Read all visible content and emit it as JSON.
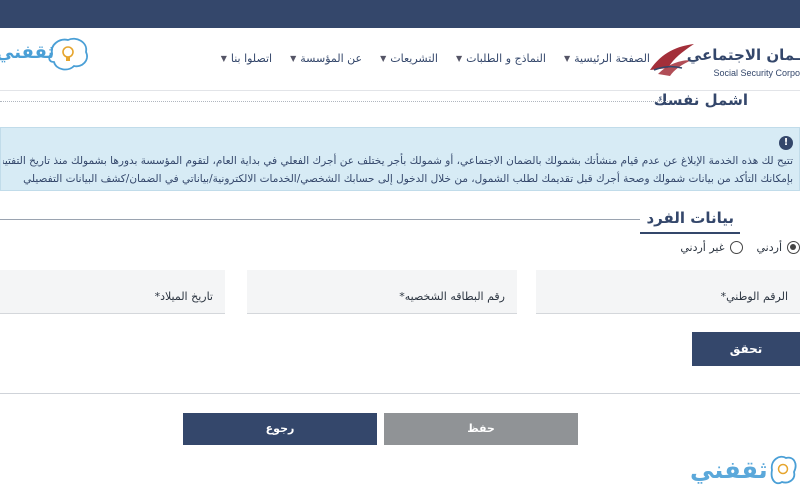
{
  "header": {
    "logo_ar": "ـمان الاجتماعي",
    "logo_en": "Social Security Corpo",
    "brand_left": "ثقفني"
  },
  "nav": {
    "items": [
      {
        "label": "الصفحة الرئيسية"
      },
      {
        "label": "النماذج و الطلبات"
      },
      {
        "label": "التشريعات"
      },
      {
        "label": "عن المؤسسة"
      },
      {
        "label": "اتصلوا بنا"
      }
    ]
  },
  "page": {
    "title": "اشمل نفسك"
  },
  "info": {
    "icon": "!",
    "line1": "تتيح لك هذه الخدمة الإبلاغ عن عدم قيام منشأتك بشمولك بالضمان الاجتماعي، أو شمولك بأجر يختلف عن أجرك الفعلي في بداية العام، لتقوم المؤسسة بدورها بشمولك منذ تاريخ التفتيش على المنش",
    "line2": "بإمكانك التأكد من بيانات شمولك وصحة أجرك قبل تقديمك لطلب الشمول، من خلال الدخول إلى حسابك الشخصي/الخدمات الالكترونية/بياناتي في الضمان/كشف البيانات التفصيلي"
  },
  "form": {
    "section_title": "بيانات الفرد",
    "radio_options": [
      {
        "label": "أردني",
        "checked": true
      },
      {
        "label": "غير أردني",
        "checked": false
      }
    ],
    "fields": {
      "national_id": "الرقم الوطني*",
      "id_card": "رقم البطاقه الشخصيه*",
      "birth_date": "تاريخ الميلاد*"
    },
    "verify_label": "تحقق"
  },
  "actions": {
    "save_label": "حفظ",
    "back_label": "رجوع"
  },
  "watermark": {
    "text": "ثقفني"
  },
  "colors": {
    "primary": "#34476b",
    "info_bg": "#d7ebf5",
    "disabled": "#909396",
    "brand_blue": "#4a9fd6"
  }
}
